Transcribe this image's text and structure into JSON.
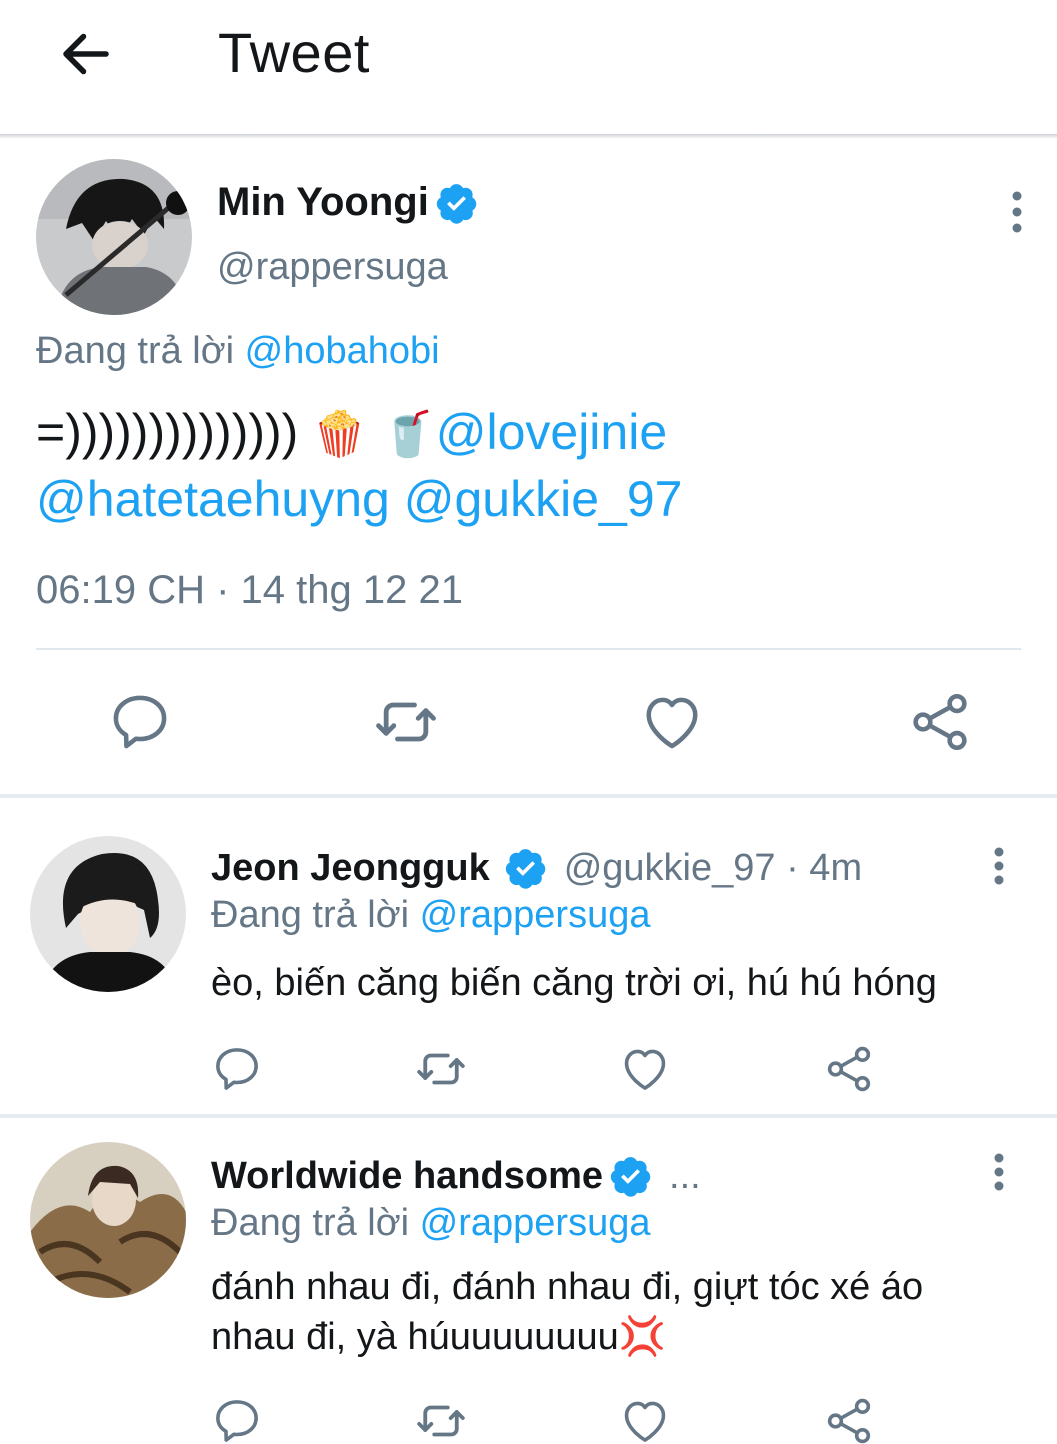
{
  "header": {
    "title": "Tweet",
    "back_icon": "arrow-left-icon"
  },
  "main_tweet": {
    "name": "Min Yoongi",
    "handle": "@rappersuga",
    "replying_prefix": "Đang trả lời",
    "replying_to": "@hobahobi",
    "text": "=))))))))))))))",
    "emoji_1": "🍿",
    "emoji_2": "🥤",
    "mention_1": "@lovejinie",
    "mention_2": "@hatetaehuyng",
    "mention_3": "@gukkie_97",
    "timestamp": "06:19 CH · 14 thg 12 21"
  },
  "replies": [
    {
      "name": "Jeon Jeongguk",
      "handle": "@gukkie_97 · 4m",
      "replying_prefix": "Đang trả lời",
      "replying_to": "@rappersuga",
      "text": "èo, biến căng biến căng trời ơi, hú hú hóng"
    },
    {
      "name": "Worldwide handsome",
      "handle": "...",
      "replying_prefix": "Đang trả lời",
      "replying_to": "@rappersuga",
      "text_line1": "đánh nhau đi, đánh nhau đi, giựt tóc xé áo",
      "text_line2": "nhau đi,  yà húuuuuuuuu",
      "emoji": "💢"
    }
  ],
  "colors": {
    "accent": "#1da1f2",
    "secondary_text": "#657786",
    "icon": "#657786"
  }
}
